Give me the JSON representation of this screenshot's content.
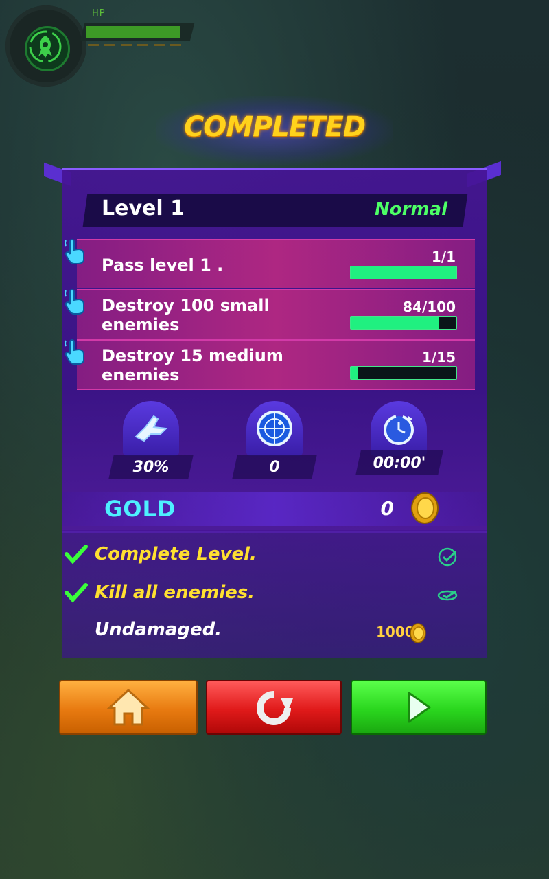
{
  "hud": {
    "hp_label": "HP",
    "hp_fraction": 0.95,
    "emblem_icon": "alien-emblem-icon"
  },
  "title": "COMPLETED",
  "level": {
    "name": "Level 1",
    "difficulty": "Normal"
  },
  "quests": [
    {
      "text_line1": "Pass level 1 .",
      "text_line2": "",
      "progress": "1/1",
      "fraction": 1.0
    },
    {
      "text_line1": "Destroy 100 small",
      "text_line2": "enemies",
      "progress": "84/100",
      "fraction": 0.84
    },
    {
      "text_line1": "Destroy 15 medium",
      "text_line2": "enemies",
      "progress": "1/15",
      "fraction": 0.067
    }
  ],
  "stats": [
    {
      "icon": "ship-icon",
      "value": "30%"
    },
    {
      "icon": "radar-icon",
      "value": "0"
    },
    {
      "icon": "clock-icon",
      "value": "00:00'"
    }
  ],
  "gold": {
    "label": "GOLD",
    "value": "0",
    "icon": "gold-coin-icon"
  },
  "objectives": [
    {
      "text": "Complete Level.",
      "done": true
    },
    {
      "text": "Kill all enemies.",
      "done": true
    },
    {
      "text": "Undamaged.",
      "done": false,
      "reward": "1000"
    }
  ],
  "buttons": {
    "home": "home-icon",
    "retry": "retry-icon",
    "next": "play-icon"
  },
  "colors": {
    "accent_green": "#4dff66",
    "title_yellow": "#ffd21c",
    "gold_label": "#4ef0ff",
    "panel_purple": "#4a1aa0"
  }
}
